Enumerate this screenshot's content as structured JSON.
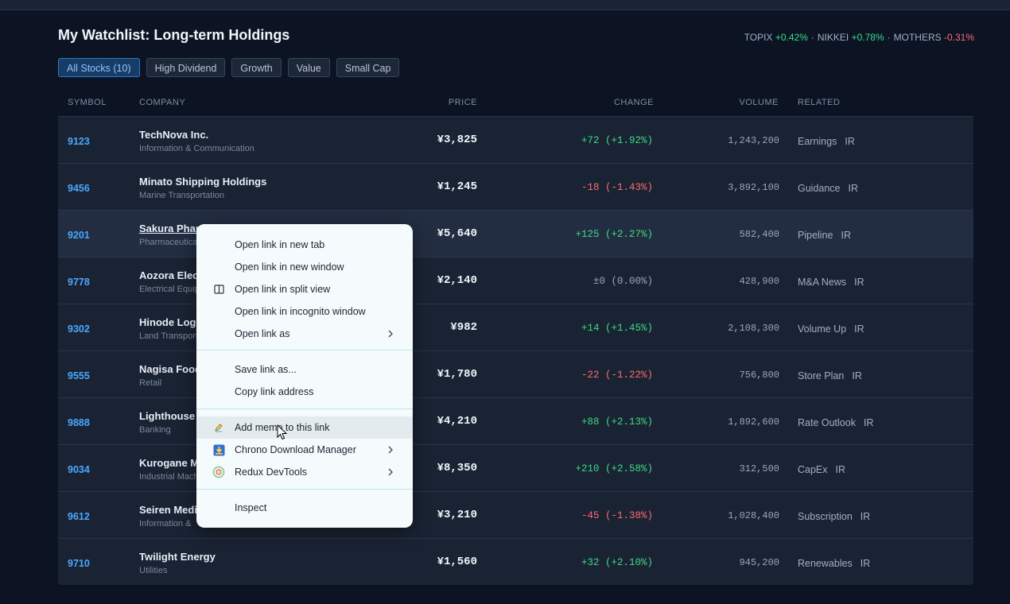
{
  "page": {
    "title": "My Watchlist: Long-term Holdings",
    "indices": [
      {
        "name": "TOPIX",
        "change": "+0.42%",
        "dir": "pos"
      },
      {
        "name": "NIKKEI",
        "change": "+0.78%",
        "dir": "pos"
      },
      {
        "name": "MOTHERS",
        "change": "-0.31%",
        "dir": "neg"
      }
    ],
    "index_separator": "·"
  },
  "tabs": [
    {
      "label": "All Stocks (10)",
      "active": true
    },
    {
      "label": "High Dividend",
      "active": false
    },
    {
      "label": "Growth",
      "active": false
    },
    {
      "label": "Value",
      "active": false
    },
    {
      "label": "Small Cap",
      "active": false
    }
  ],
  "table": {
    "headers": {
      "symbol": "SYMBOL",
      "company": "COMPANY",
      "price": "PRICE",
      "change": "CHANGE",
      "volume": "VOLUME",
      "related": "RELATED"
    },
    "rows": [
      {
        "symbol": "9123",
        "company": "TechNova Inc.",
        "sector": "Information & Communication",
        "price": "¥3,825",
        "change": "+72 (+1.92%)",
        "dir": "pos",
        "volume": "1,243,200",
        "related": "Earnings",
        "ir": "IR"
      },
      {
        "symbol": "9456",
        "company": "Minato Shipping Holdings",
        "sector": "Marine Transportation",
        "price": "¥1,245",
        "change": "-18 (-1.43%)",
        "dir": "neg",
        "volume": "3,892,100",
        "related": "Guidance",
        "ir": "IR"
      },
      {
        "symbol": "9201",
        "company": "Sakura Pharm",
        "sector": "Pharmaceutical",
        "price": "¥5,640",
        "change": "+125 (+2.27%)",
        "dir": "pos",
        "volume": "582,400",
        "related": "Pipeline",
        "ir": "IR"
      },
      {
        "symbol": "9778",
        "company": "Aozora Elect",
        "sector": "Electrical Equip",
        "price": "¥2,140",
        "change": "±0 (0.00%)",
        "dir": "flat",
        "volume": "428,900",
        "related": "M&A News",
        "ir": "IR"
      },
      {
        "symbol": "9302",
        "company": "Hinode Logi",
        "sector": "Land Transport",
        "price": "¥982",
        "change": "+14 (+1.45%)",
        "dir": "pos",
        "volume": "2,108,300",
        "related": "Volume Up",
        "ir": "IR"
      },
      {
        "symbol": "9555",
        "company": "Nagisa Food",
        "sector": "Retail",
        "price": "¥1,780",
        "change": "-22 (-1.22%)",
        "dir": "neg",
        "volume": "756,800",
        "related": "Store Plan",
        "ir": "IR"
      },
      {
        "symbol": "9888",
        "company": "Lighthouse B",
        "sector": "Banking",
        "price": "¥4,210",
        "change": "+88 (+2.13%)",
        "dir": "pos",
        "volume": "1,892,600",
        "related": "Rate Outlook",
        "ir": "IR"
      },
      {
        "symbol": "9034",
        "company": "Kurogane M",
        "sector": "Industrial Mach",
        "price": "¥8,350",
        "change": "+210 (+2.58%)",
        "dir": "pos",
        "volume": "312,500",
        "related": "CapEx",
        "ir": "IR"
      },
      {
        "symbol": "9612",
        "company": "Seiren Media",
        "sector": "Information &",
        "price": "¥3,210",
        "change": "-45 (-1.38%)",
        "dir": "neg",
        "volume": "1,028,400",
        "related": "Subscription",
        "ir": "IR"
      },
      {
        "symbol": "9710",
        "company": "Twilight Energy",
        "sector": "Utilities",
        "price": "¥1,560",
        "change": "+32 (+2.10%)",
        "dir": "pos",
        "volume": "945,200",
        "related": "Renewables",
        "ir": "IR"
      }
    ]
  },
  "context_menu": {
    "groups": [
      [
        {
          "label": "Open link in new tab",
          "icon": "",
          "submenu": false
        },
        {
          "label": "Open link in new window",
          "icon": "",
          "submenu": false
        },
        {
          "label": "Open link in split view",
          "icon": "split-view-icon",
          "submenu": false
        },
        {
          "label": "Open link in incognito window",
          "icon": "",
          "submenu": false
        },
        {
          "label": "Open link as",
          "icon": "",
          "submenu": true
        }
      ],
      [
        {
          "label": "Save link as...",
          "icon": "",
          "submenu": false
        },
        {
          "label": "Copy link address",
          "icon": "",
          "submenu": false
        }
      ],
      [
        {
          "label": "Add memo to this link",
          "icon": "memo-pen-icon",
          "submenu": false,
          "hovered": true
        },
        {
          "label": "Chrono Download Manager",
          "icon": "download-manager-icon",
          "submenu": true
        },
        {
          "label": "Redux DevTools",
          "icon": "redux-devtools-icon",
          "submenu": true
        }
      ],
      [
        {
          "label": "Inspect",
          "icon": "",
          "submenu": false
        }
      ]
    ]
  },
  "colors": {
    "background": "#0c1424",
    "accent": "#4aa8ff",
    "positive": "#3ddc84",
    "negative": "#ff6b6b"
  }
}
